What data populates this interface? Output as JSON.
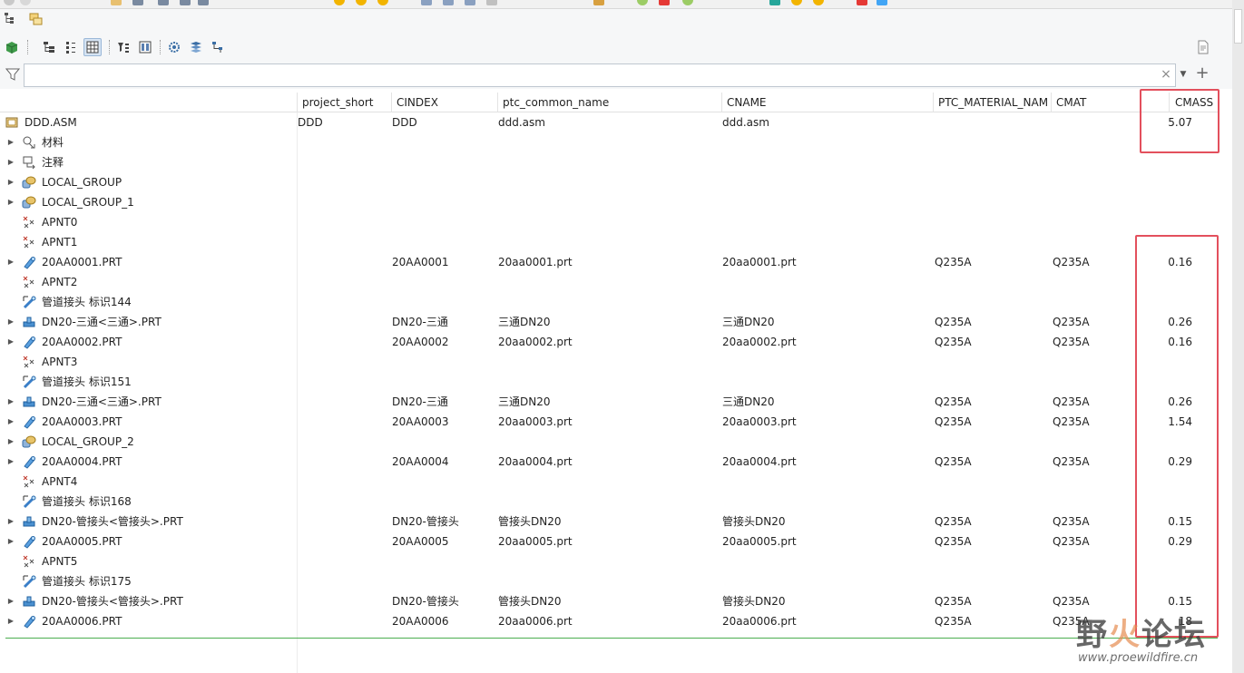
{
  "filter": {
    "value": "",
    "placeholder": ""
  },
  "columns": [
    {
      "key": "name",
      "label": ""
    },
    {
      "key": "project_short",
      "label": "project_short"
    },
    {
      "key": "cindex",
      "label": "CINDEX"
    },
    {
      "key": "ptc_common_name",
      "label": "ptc_common_name"
    },
    {
      "key": "cname",
      "label": "CNAME"
    },
    {
      "key": "ptc_material_name",
      "label": "PTC_MATERIAL_NAM"
    },
    {
      "key": "cmat",
      "label": "CMAT"
    },
    {
      "key": "cmass",
      "label": "CMASS"
    }
  ],
  "rows": [
    {
      "name": "DDD.ASM",
      "icon": "assembly-icon",
      "expander": false,
      "project_short": "DDD",
      "cindex": "DDD",
      "ptc_common_name": "ddd.asm",
      "cname": "ddd.asm",
      "ptc_material_name": "",
      "cmat": "",
      "cmass": "5.07"
    },
    {
      "name": "材料",
      "icon": "materials-icon",
      "expander": true,
      "project_short": "",
      "cindex": "",
      "ptc_common_name": "",
      "cname": "",
      "ptc_material_name": "",
      "cmat": "",
      "cmass": ""
    },
    {
      "name": "注释",
      "icon": "annotation-icon",
      "expander": true,
      "project_short": "",
      "cindex": "",
      "ptc_common_name": "",
      "cname": "",
      "ptc_material_name": "",
      "cmat": "",
      "cmass": ""
    },
    {
      "name": "LOCAL_GROUP",
      "icon": "group-icon",
      "expander": true,
      "project_short": "",
      "cindex": "",
      "ptc_common_name": "",
      "cname": "",
      "ptc_material_name": "",
      "cmat": "",
      "cmass": ""
    },
    {
      "name": "LOCAL_GROUP_1",
      "icon": "group-icon",
      "expander": true,
      "project_short": "",
      "cindex": "",
      "ptc_common_name": "",
      "cname": "",
      "ptc_material_name": "",
      "cmat": "",
      "cmass": ""
    },
    {
      "name": "APNT0",
      "icon": "datum-point-icon",
      "expander": false,
      "project_short": "",
      "cindex": "",
      "ptc_common_name": "",
      "cname": "",
      "ptc_material_name": "",
      "cmat": "",
      "cmass": ""
    },
    {
      "name": "APNT1",
      "icon": "datum-point-icon",
      "expander": false,
      "project_short": "",
      "cindex": "",
      "ptc_common_name": "",
      "cname": "",
      "ptc_material_name": "",
      "cmat": "",
      "cmass": ""
    },
    {
      "name": "20AA0001.PRT",
      "icon": "pipe-part-icon",
      "expander": true,
      "project_short": "",
      "cindex": "20AA0001",
      "ptc_common_name": "20aa0001.prt",
      "cname": "20aa0001.prt",
      "ptc_material_name": "Q235A",
      "cmat": "Q235A",
      "cmass": "0.16"
    },
    {
      "name": "APNT2",
      "icon": "datum-point-icon",
      "expander": false,
      "project_short": "",
      "cindex": "",
      "ptc_common_name": "",
      "cname": "",
      "ptc_material_name": "",
      "cmat": "",
      "cmass": ""
    },
    {
      "name": "管道接头 标识144",
      "icon": "pipe-connector-icon",
      "expander": false,
      "project_short": "",
      "cindex": "",
      "ptc_common_name": "",
      "cname": "",
      "ptc_material_name": "",
      "cmat": "",
      "cmass": ""
    },
    {
      "name": "DN20-三通<三通>.PRT",
      "icon": "fitting-part-icon",
      "expander": true,
      "project_short": "",
      "cindex": "DN20-三通",
      "ptc_common_name": "三通DN20",
      "cname": "三通DN20",
      "ptc_material_name": "Q235A",
      "cmat": "Q235A",
      "cmass": "0.26"
    },
    {
      "name": "20AA0002.PRT",
      "icon": "pipe-part-icon",
      "expander": true,
      "project_short": "",
      "cindex": "20AA0002",
      "ptc_common_name": "20aa0002.prt",
      "cname": "20aa0002.prt",
      "ptc_material_name": "Q235A",
      "cmat": "Q235A",
      "cmass": "0.16"
    },
    {
      "name": "APNT3",
      "icon": "datum-point-icon",
      "expander": false,
      "project_short": "",
      "cindex": "",
      "ptc_common_name": "",
      "cname": "",
      "ptc_material_name": "",
      "cmat": "",
      "cmass": ""
    },
    {
      "name": "管道接头 标识151",
      "icon": "pipe-connector-icon",
      "expander": false,
      "project_short": "",
      "cindex": "",
      "ptc_common_name": "",
      "cname": "",
      "ptc_material_name": "",
      "cmat": "",
      "cmass": ""
    },
    {
      "name": "DN20-三通<三通>.PRT",
      "icon": "fitting-part-icon",
      "expander": true,
      "project_short": "",
      "cindex": "DN20-三通",
      "ptc_common_name": "三通DN20",
      "cname": "三通DN20",
      "ptc_material_name": "Q235A",
      "cmat": "Q235A",
      "cmass": "0.26"
    },
    {
      "name": "20AA0003.PRT",
      "icon": "pipe-part-icon",
      "expander": true,
      "project_short": "",
      "cindex": "20AA0003",
      "ptc_common_name": "20aa0003.prt",
      "cname": "20aa0003.prt",
      "ptc_material_name": "Q235A",
      "cmat": "Q235A",
      "cmass": "1.54"
    },
    {
      "name": "LOCAL_GROUP_2",
      "icon": "group-icon",
      "expander": true,
      "project_short": "",
      "cindex": "",
      "ptc_common_name": "",
      "cname": "",
      "ptc_material_name": "",
      "cmat": "",
      "cmass": ""
    },
    {
      "name": "20AA0004.PRT",
      "icon": "pipe-part-icon",
      "expander": true,
      "project_short": "",
      "cindex": "20AA0004",
      "ptc_common_name": "20aa0004.prt",
      "cname": "20aa0004.prt",
      "ptc_material_name": "Q235A",
      "cmat": "Q235A",
      "cmass": "0.29"
    },
    {
      "name": "APNT4",
      "icon": "datum-point-icon",
      "expander": false,
      "project_short": "",
      "cindex": "",
      "ptc_common_name": "",
      "cname": "",
      "ptc_material_name": "",
      "cmat": "",
      "cmass": ""
    },
    {
      "name": "管道接头 标识168",
      "icon": "pipe-connector-icon",
      "expander": false,
      "project_short": "",
      "cindex": "",
      "ptc_common_name": "",
      "cname": "",
      "ptc_material_name": "",
      "cmat": "",
      "cmass": ""
    },
    {
      "name": "DN20-管接头<管接头>.PRT",
      "icon": "fitting-part-icon",
      "expander": true,
      "project_short": "",
      "cindex": "DN20-管接头",
      "ptc_common_name": "管接头DN20",
      "cname": "管接头DN20",
      "ptc_material_name": "Q235A",
      "cmat": "Q235A",
      "cmass": "0.15"
    },
    {
      "name": "20AA0005.PRT",
      "icon": "pipe-part-icon",
      "expander": true,
      "project_short": "",
      "cindex": "20AA0005",
      "ptc_common_name": "20aa0005.prt",
      "cname": "20aa0005.prt",
      "ptc_material_name": "Q235A",
      "cmat": "Q235A",
      "cmass": "0.29"
    },
    {
      "name": "APNT5",
      "icon": "datum-point-icon",
      "expander": false,
      "project_short": "",
      "cindex": "",
      "ptc_common_name": "",
      "cname": "",
      "ptc_material_name": "",
      "cmat": "",
      "cmass": ""
    },
    {
      "name": "管道接头 标识175",
      "icon": "pipe-connector-icon",
      "expander": false,
      "project_short": "",
      "cindex": "",
      "ptc_common_name": "",
      "cname": "",
      "ptc_material_name": "",
      "cmat": "",
      "cmass": ""
    },
    {
      "name": "DN20-管接头<管接头>.PRT",
      "icon": "fitting-part-icon",
      "expander": true,
      "project_short": "",
      "cindex": "DN20-管接头",
      "ptc_common_name": "管接头DN20",
      "cname": "管接头DN20",
      "ptc_material_name": "Q235A",
      "cmat": "Q235A",
      "cmass": "0.15"
    },
    {
      "name": "20AA0006.PRT",
      "icon": "pipe-part-icon",
      "expander": true,
      "project_short": "",
      "cindex": "20AA0006",
      "ptc_common_name": "20aa0006.prt",
      "cname": "20aa0006.prt",
      "ptc_material_name": "Q235A",
      "cmat": "Q235A",
      "cmass": "18"
    }
  ],
  "watermark": {
    "title": "野火论坛",
    "site": "www.proewildfire.cn"
  },
  "colors": {
    "highlight": "#e3505d",
    "baseline": "#4caf50"
  }
}
